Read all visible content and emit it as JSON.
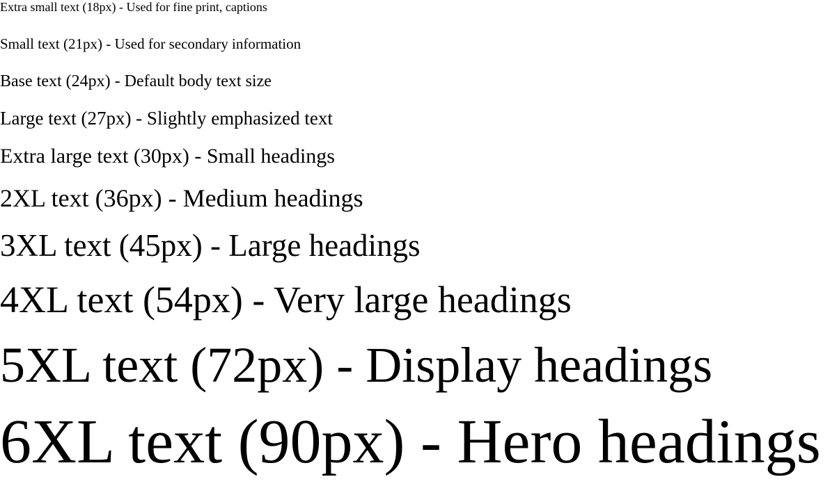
{
  "samples": [
    {
      "text": "Extra small text (18px) - Used for fine print, captions"
    },
    {
      "text": "Small text (21px) - Used for secondary information"
    },
    {
      "text": "Base text (24px) - Default body text size"
    },
    {
      "text": "Large text (27px) - Slightly emphasized text"
    },
    {
      "text": "Extra large text (30px) - Small headings"
    },
    {
      "text": "2XL text (36px) - Medium headings"
    },
    {
      "text": "3XL text (45px) - Large headings"
    },
    {
      "text": "4XL text (54px) - Very large headings"
    },
    {
      "text": "5XL text (72px) - Display headings"
    },
    {
      "text": "6XL text (90px) - Hero headings"
    }
  ]
}
